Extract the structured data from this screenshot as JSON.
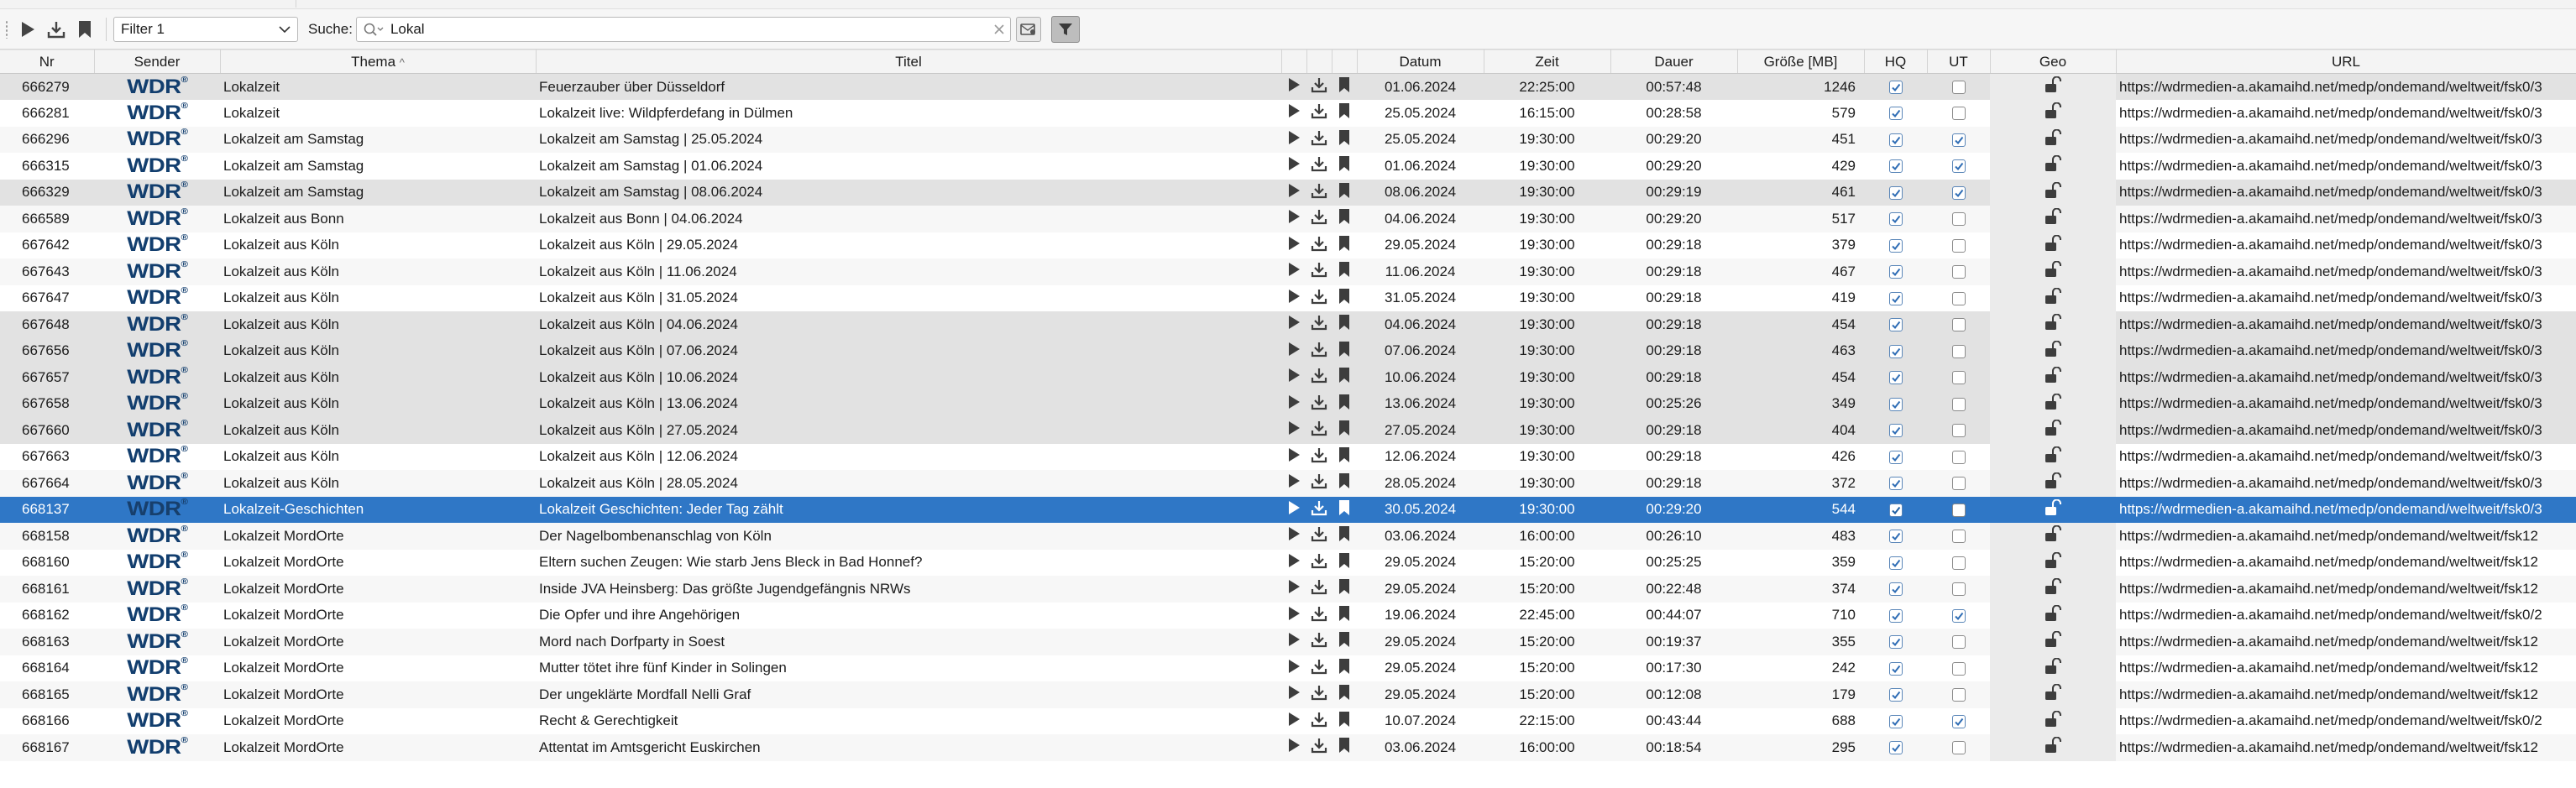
{
  "toolbar": {
    "filter_value": "Filter 1",
    "search_label": "Suche:",
    "search_value": "Lokal"
  },
  "columns": [
    "Nr",
    "Sender",
    "Thema",
    "Titel",
    "",
    "",
    "",
    "Datum",
    "Zeit",
    "Dauer",
    "Größe [MB]",
    "HQ",
    "UT",
    "Geo",
    "URL"
  ],
  "sort_indicator": "^",
  "channel_logo": "WDR",
  "rows": [
    {
      "nr": "666279",
      "thema": "Lokalzeit",
      "titel": "Feuerzauber über Düsseldorf",
      "datum": "01.06.2024",
      "zeit": "22:25:00",
      "dauer": "00:57:48",
      "groesse": "1246",
      "hq": true,
      "ut": false,
      "url": "https://wdrmedien-a.akamaihd.net/medp/ondemand/weltweit/fsk0/3",
      "state": "hl"
    },
    {
      "nr": "666281",
      "thema": "Lokalzeit",
      "titel": "Lokalzeit live: Wildpferdefang in Dülmen",
      "datum": "25.05.2024",
      "zeit": "16:15:00",
      "dauer": "00:28:58",
      "groesse": "579",
      "hq": true,
      "ut": false,
      "url": "https://wdrmedien-a.akamaihd.net/medp/ondemand/weltweit/fsk0/3",
      "state": ""
    },
    {
      "nr": "666296",
      "thema": "Lokalzeit am Samstag",
      "titel": "Lokalzeit am Samstag | 25.05.2024",
      "datum": "25.05.2024",
      "zeit": "19:30:00",
      "dauer": "00:29:20",
      "groesse": "451",
      "hq": true,
      "ut": true,
      "url": "https://wdrmedien-a.akamaihd.net/medp/ondemand/weltweit/fsk0/3",
      "state": "alt"
    },
    {
      "nr": "666315",
      "thema": "Lokalzeit am Samstag",
      "titel": "Lokalzeit am Samstag | 01.06.2024",
      "datum": "01.06.2024",
      "zeit": "19:30:00",
      "dauer": "00:29:20",
      "groesse": "429",
      "hq": true,
      "ut": true,
      "url": "https://wdrmedien-a.akamaihd.net/medp/ondemand/weltweit/fsk0/3",
      "state": ""
    },
    {
      "nr": "666329",
      "thema": "Lokalzeit am Samstag",
      "titel": "Lokalzeit am Samstag | 08.06.2024",
      "datum": "08.06.2024",
      "zeit": "19:30:00",
      "dauer": "00:29:19",
      "groesse": "461",
      "hq": true,
      "ut": true,
      "url": "https://wdrmedien-a.akamaihd.net/medp/ondemand/weltweit/fsk0/3",
      "state": "hl"
    },
    {
      "nr": "666589",
      "thema": "Lokalzeit aus Bonn",
      "titel": "Lokalzeit aus Bonn | 04.06.2024",
      "datum": "04.06.2024",
      "zeit": "19:30:00",
      "dauer": "00:29:20",
      "groesse": "517",
      "hq": true,
      "ut": false,
      "url": "https://wdrmedien-a.akamaihd.net/medp/ondemand/weltweit/fsk0/3",
      "state": "alt"
    },
    {
      "nr": "667642",
      "thema": "Lokalzeit aus Köln",
      "titel": "Lokalzeit aus Köln  | 29.05.2024",
      "datum": "29.05.2024",
      "zeit": "19:30:00",
      "dauer": "00:29:18",
      "groesse": "379",
      "hq": true,
      "ut": false,
      "url": "https://wdrmedien-a.akamaihd.net/medp/ondemand/weltweit/fsk0/3",
      "state": ""
    },
    {
      "nr": "667643",
      "thema": "Lokalzeit aus Köln",
      "titel": "Lokalzeit aus Köln | 11.06.2024",
      "datum": "11.06.2024",
      "zeit": "19:30:00",
      "dauer": "00:29:18",
      "groesse": "467",
      "hq": true,
      "ut": false,
      "url": "https://wdrmedien-a.akamaihd.net/medp/ondemand/weltweit/fsk0/3",
      "state": "alt"
    },
    {
      "nr": "667647",
      "thema": "Lokalzeit aus Köln",
      "titel": "Lokalzeit aus Köln | 31.05.2024",
      "datum": "31.05.2024",
      "zeit": "19:30:00",
      "dauer": "00:29:18",
      "groesse": "419",
      "hq": true,
      "ut": false,
      "url": "https://wdrmedien-a.akamaihd.net/medp/ondemand/weltweit/fsk0/3",
      "state": ""
    },
    {
      "nr": "667648",
      "thema": "Lokalzeit aus Köln",
      "titel": "Lokalzeit aus Köln | 04.06.2024",
      "datum": "04.06.2024",
      "zeit": "19:30:00",
      "dauer": "00:29:18",
      "groesse": "454",
      "hq": true,
      "ut": false,
      "url": "https://wdrmedien-a.akamaihd.net/medp/ondemand/weltweit/fsk0/3",
      "state": "hl"
    },
    {
      "nr": "667656",
      "thema": "Lokalzeit aus Köln",
      "titel": "Lokalzeit aus Köln | 07.06.2024",
      "datum": "07.06.2024",
      "zeit": "19:30:00",
      "dauer": "00:29:18",
      "groesse": "463",
      "hq": true,
      "ut": false,
      "url": "https://wdrmedien-a.akamaihd.net/medp/ondemand/weltweit/fsk0/3",
      "state": "hl"
    },
    {
      "nr": "667657",
      "thema": "Lokalzeit aus Köln",
      "titel": "Lokalzeit aus Köln | 10.06.2024",
      "datum": "10.06.2024",
      "zeit": "19:30:00",
      "dauer": "00:29:18",
      "groesse": "454",
      "hq": true,
      "ut": false,
      "url": "https://wdrmedien-a.akamaihd.net/medp/ondemand/weltweit/fsk0/3",
      "state": "hl"
    },
    {
      "nr": "667658",
      "thema": "Lokalzeit aus Köln",
      "titel": "Lokalzeit aus Köln | 13.06.2024",
      "datum": "13.06.2024",
      "zeit": "19:30:00",
      "dauer": "00:25:26",
      "groesse": "349",
      "hq": true,
      "ut": false,
      "url": "https://wdrmedien-a.akamaihd.net/medp/ondemand/weltweit/fsk0/3",
      "state": "hl"
    },
    {
      "nr": "667660",
      "thema": "Lokalzeit aus Köln",
      "titel": "Lokalzeit aus Köln | 27.05.2024",
      "datum": "27.05.2024",
      "zeit": "19:30:00",
      "dauer": "00:29:18",
      "groesse": "404",
      "hq": true,
      "ut": false,
      "url": "https://wdrmedien-a.akamaihd.net/medp/ondemand/weltweit/fsk0/3",
      "state": "hl"
    },
    {
      "nr": "667663",
      "thema": "Lokalzeit aus Köln",
      "titel": "Lokalzeit aus Köln | 12.06.2024",
      "datum": "12.06.2024",
      "zeit": "19:30:00",
      "dauer": "00:29:18",
      "groesse": "426",
      "hq": true,
      "ut": false,
      "url": "https://wdrmedien-a.akamaihd.net/medp/ondemand/weltweit/fsk0/3",
      "state": ""
    },
    {
      "nr": "667664",
      "thema": "Lokalzeit aus Köln",
      "titel": "Lokalzeit aus Köln | 28.05.2024",
      "datum": "28.05.2024",
      "zeit": "19:30:00",
      "dauer": "00:29:18",
      "groesse": "372",
      "hq": true,
      "ut": false,
      "url": "https://wdrmedien-a.akamaihd.net/medp/ondemand/weltweit/fsk0/3",
      "state": "alt"
    },
    {
      "nr": "668137",
      "thema": "Lokalzeit-Geschichten",
      "titel": "Lokalzeit Geschichten: Jeder Tag zählt",
      "datum": "30.05.2024",
      "zeit": "19:30:00",
      "dauer": "00:29:20",
      "groesse": "544",
      "hq": true,
      "ut": false,
      "url": "https://wdrmedien-a.akamaihd.net/medp/ondemand/weltweit/fsk0/3",
      "state": "sel"
    },
    {
      "nr": "668158",
      "thema": "Lokalzeit MordOrte",
      "titel": "Der Nagelbombenanschlag von Köln",
      "datum": "03.06.2024",
      "zeit": "16:00:00",
      "dauer": "00:26:10",
      "groesse": "483",
      "hq": true,
      "ut": false,
      "url": "https://wdrmedien-a.akamaihd.net/medp/ondemand/weltweit/fsk12",
      "state": "alt"
    },
    {
      "nr": "668160",
      "thema": "Lokalzeit MordOrte",
      "titel": "Eltern suchen Zeugen: Wie starb Jens Bleck in Bad Honnef?",
      "datum": "29.05.2024",
      "zeit": "15:20:00",
      "dauer": "00:25:25",
      "groesse": "359",
      "hq": true,
      "ut": false,
      "url": "https://wdrmedien-a.akamaihd.net/medp/ondemand/weltweit/fsk12",
      "state": ""
    },
    {
      "nr": "668161",
      "thema": "Lokalzeit MordOrte",
      "titel": "Inside JVA Heinsberg: Das größte Jugendgefängnis NRWs",
      "datum": "29.05.2024",
      "zeit": "15:20:00",
      "dauer": "00:22:48",
      "groesse": "374",
      "hq": true,
      "ut": false,
      "url": "https://wdrmedien-a.akamaihd.net/medp/ondemand/weltweit/fsk12",
      "state": "alt"
    },
    {
      "nr": "668162",
      "thema": "Lokalzeit MordOrte",
      "titel": "Die Opfer und ihre Angehörigen",
      "datum": "19.06.2024",
      "zeit": "22:45:00",
      "dauer": "00:44:07",
      "groesse": "710",
      "hq": true,
      "ut": true,
      "url": "https://wdrmedien-a.akamaihd.net/medp/ondemand/weltweit/fsk0/2",
      "state": ""
    },
    {
      "nr": "668163",
      "thema": "Lokalzeit MordOrte",
      "titel": "Mord nach Dorfparty in Soest",
      "datum": "29.05.2024",
      "zeit": "15:20:00",
      "dauer": "00:19:37",
      "groesse": "355",
      "hq": true,
      "ut": false,
      "url": "https://wdrmedien-a.akamaihd.net/medp/ondemand/weltweit/fsk12",
      "state": "alt"
    },
    {
      "nr": "668164",
      "thema": "Lokalzeit MordOrte",
      "titel": "Mutter tötet ihre fünf Kinder in Solingen",
      "datum": "29.05.2024",
      "zeit": "15:20:00",
      "dauer": "00:17:30",
      "groesse": "242",
      "hq": true,
      "ut": false,
      "url": "https://wdrmedien-a.akamaihd.net/medp/ondemand/weltweit/fsk12",
      "state": ""
    },
    {
      "nr": "668165",
      "thema": "Lokalzeit MordOrte",
      "titel": "Der ungeklärte Mordfall Nelli Graf",
      "datum": "29.05.2024",
      "zeit": "15:20:00",
      "dauer": "00:12:08",
      "groesse": "179",
      "hq": true,
      "ut": false,
      "url": "https://wdrmedien-a.akamaihd.net/medp/ondemand/weltweit/fsk12",
      "state": "alt"
    },
    {
      "nr": "668166",
      "thema": "Lokalzeit MordOrte",
      "titel": "Recht & Gerechtigkeit",
      "datum": "10.07.2024",
      "zeit": "22:15:00",
      "dauer": "00:43:44",
      "groesse": "688",
      "hq": true,
      "ut": true,
      "url": "https://wdrmedien-a.akamaihd.net/medp/ondemand/weltweit/fsk0/2",
      "state": ""
    },
    {
      "nr": "668167",
      "thema": "Lokalzeit MordOrte",
      "titel": "Attentat im Amtsgericht Euskirchen",
      "datum": "03.06.2024",
      "zeit": "16:00:00",
      "dauer": "00:18:54",
      "groesse": "295",
      "hq": true,
      "ut": false,
      "url": "https://wdrmedien-a.akamaihd.net/medp/ondemand/weltweit/fsk12",
      "state": "alt"
    }
  ],
  "colors": {
    "selection": "#2f77c6",
    "highlight_row": "#e2e2e2",
    "wdr_logo": "#123e6e",
    "checkbox_check": "#2f6db5"
  },
  "icons": {
    "play": "play-icon",
    "download": "download-icon",
    "bookmark": "bookmark-icon",
    "geo": "unlock-icon"
  }
}
